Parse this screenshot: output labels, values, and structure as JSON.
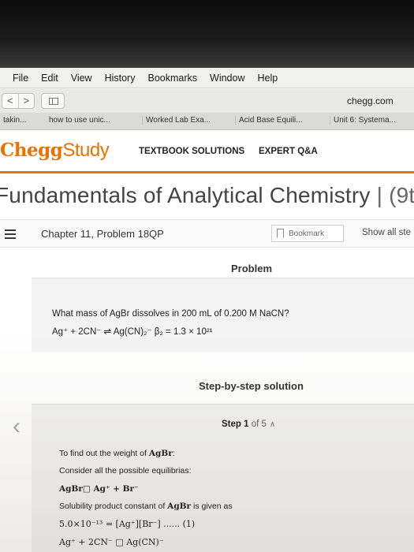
{
  "menubar": [
    "File",
    "Edit",
    "View",
    "History",
    "Bookmarks",
    "Window",
    "Help"
  ],
  "toolbar": {
    "back": "<",
    "forward": ">",
    "url": "chegg.com"
  },
  "favorites": [
    "takin...",
    "how to use unic...",
    "Worked Lab Exa...",
    "Acid Base Equili...",
    "Unit 6: Systema..."
  ],
  "header": {
    "logo_chegg": "Chegg",
    "logo_study": "Study",
    "nav": [
      "TEXTBOOK SOLUTIONS",
      "EXPERT Q&A"
    ]
  },
  "book": {
    "title": "Fundamentals of Analytical Chemistry",
    "edition": "(9t"
  },
  "chapter": {
    "label": "Chapter 11, Problem 18QP",
    "bookmark": "Bookmark",
    "show_all": "Show all ste"
  },
  "problem": {
    "heading": "Problem",
    "question": "What mass of AgBr dissolves in 200 mL of 0.200 M NaCN?",
    "equation": "Ag⁺ + 2CN⁻ ⇌ Ag(CN)₂⁻ β₂ = 1.3 × 10²¹"
  },
  "solution": {
    "heading": "Step-by-step solution",
    "step_label": "Step",
    "step_num": "1",
    "step_of": "of 5",
    "lines": {
      "l1a": "To find out the weight of ",
      "l1b": "AgBr",
      "l1c": ":",
      "l2": "Consider all the possible equilibrias:",
      "l3": "AgBr□ Ag⁺ + Br⁻",
      "l4a": "Solubility product constant of ",
      "l4b": "AgBr",
      "l4c": " is given as",
      "l5": "5.0×10⁻¹³ = [Ag⁺][Br⁻] ...... (1)",
      "l6": "Ag⁺ + 2CN⁻ □ Ag(CN)⁻"
    }
  }
}
